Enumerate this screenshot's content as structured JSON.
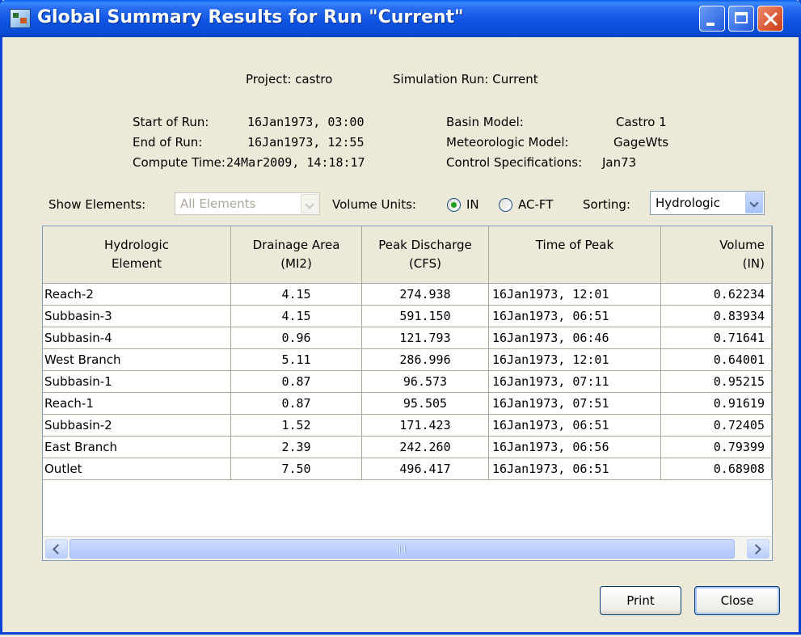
{
  "window": {
    "title": "Global Summary Results for Run \"Current\""
  },
  "info": {
    "project": "Project: castro",
    "simulation_run": "Simulation Run: Current",
    "start_label": "Start of Run:",
    "start_value": "16Jan1973, 03:00",
    "end_label": "End of Run:",
    "end_value": "16Jan1973, 12:55",
    "compute_label": "Compute Time:",
    "compute_value": "24Mar2009, 14:18:17",
    "basin_label": "Basin Model:",
    "basin_value": "Castro 1",
    "met_label": "Meteorologic Model:",
    "met_value": "GageWts",
    "control_label": "Control Specifications:",
    "control_value": "Jan73"
  },
  "controls": {
    "show_elements_label": "Show Elements:",
    "show_elements_value": "All Elements",
    "volume_units_label": "Volume Units:",
    "unit_in": "IN",
    "unit_acft": "AC-FT",
    "selected_unit": "IN",
    "sorting_label": "Sorting:",
    "sorting_value": "Hydrologic"
  },
  "table": {
    "headers": [
      {
        "line1": "Hydrologic",
        "line2": "Element"
      },
      {
        "line1": "Drainage Area",
        "line2": "(MI2)"
      },
      {
        "line1": "Peak Discharge",
        "line2": "(CFS)"
      },
      {
        "line1": "Time of Peak",
        "line2": ""
      },
      {
        "line1": "Volume",
        "line2": "(IN)"
      }
    ],
    "rows": [
      [
        "Reach-2",
        "4.15",
        "274.938",
        "16Jan1973, 12:01",
        "0.62234"
      ],
      [
        "Subbasin-3",
        "4.15",
        "591.150",
        "16Jan1973, 06:51",
        "0.83934"
      ],
      [
        "Subbasin-4",
        "0.96",
        "121.793",
        "16Jan1973, 06:46",
        "0.71641"
      ],
      [
        "West Branch",
        "5.11",
        "286.996",
        "16Jan1973, 12:01",
        "0.64001"
      ],
      [
        "Subbasin-1",
        "0.87",
        "96.573",
        "16Jan1973, 07:11",
        "0.95215"
      ],
      [
        "Reach-1",
        "0.87",
        "95.505",
        "16Jan1973, 07:51",
        "0.91619"
      ],
      [
        "Subbasin-2",
        "1.52",
        "171.423",
        "16Jan1973, 06:51",
        "0.72405"
      ],
      [
        "East Branch",
        "2.39",
        "242.260",
        "16Jan1973, 06:56",
        "0.79399"
      ],
      [
        "Outlet",
        "7.50",
        "496.417",
        "16Jan1973, 06:51",
        "0.68908"
      ]
    ]
  },
  "buttons": {
    "print": "Print",
    "close": "Close"
  }
}
